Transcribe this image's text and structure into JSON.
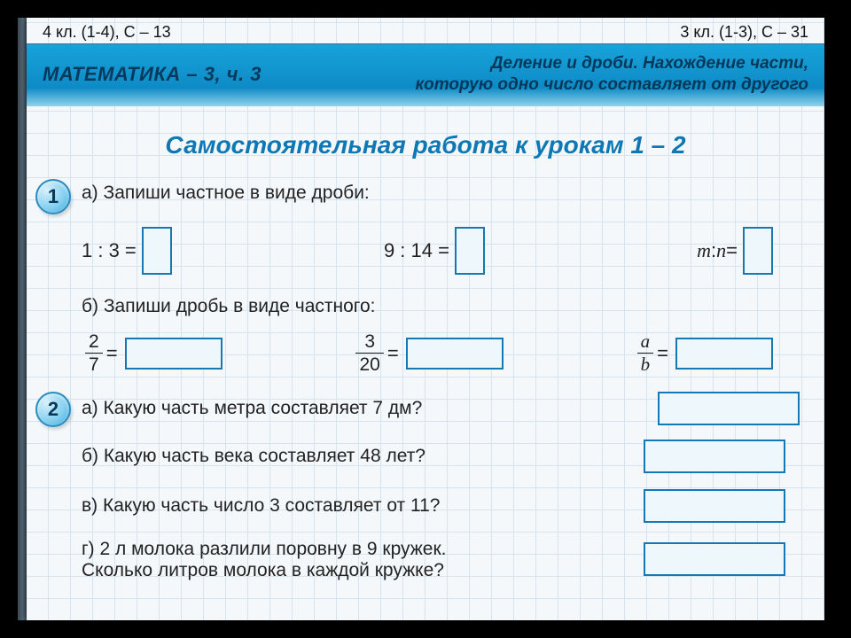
{
  "top": {
    "left": "4 кл. (1-4), С – 13",
    "right": "3 кл. (1-3), С – 31"
  },
  "banner": {
    "left": "МАТЕМАТИКА – 3, ч. 3",
    "right1": "Деление и дроби. Нахождение части,",
    "right2": "которую одно число составляет от другого"
  },
  "heading": "Самостоятельная работа к урокам 1 – 2",
  "task1": {
    "num": "1",
    "a_label": "а) Запиши частное в виде дроби:",
    "eq1": "1 : 3 =",
    "eq2": "9 : 14 =",
    "eq3_l": "m",
    "eq3_m": " : ",
    "eq3_r": "n",
    "eq3_eq": " =",
    "b_label": "б) Запиши дробь в виде частного:",
    "f1n": "2",
    "f1d": "7",
    "f2n": "3",
    "f2d": "20",
    "f3n": "a",
    "f3d": "b",
    "eqs": " ="
  },
  "task2": {
    "num": "2",
    "a": "а) Какую часть метра составляет 7 дм?",
    "b": "б) Какую часть века составляет 48 лет?",
    "c": "в) Какую часть число 3 составляет от 11?",
    "d1": "г) 2 л молока разлили поровну в 9 кружек.",
    "d2": "Сколько литров молока в каждой кружке?"
  }
}
